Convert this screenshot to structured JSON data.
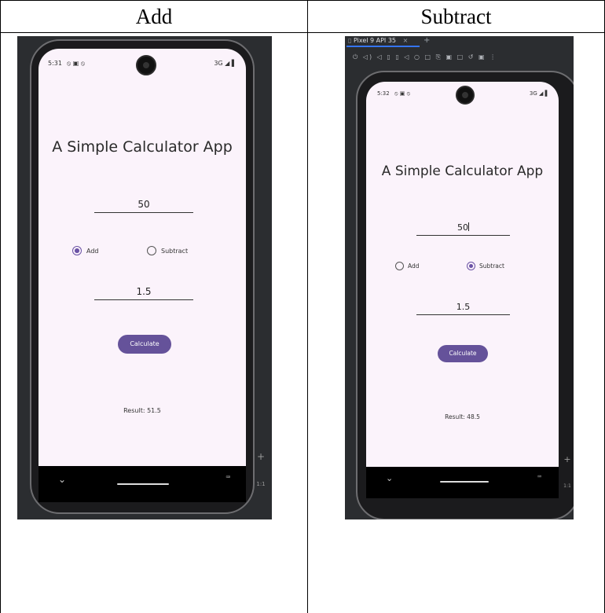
{
  "headers": {
    "left": "Add",
    "right": "Subtract"
  },
  "left_phone": {
    "time": "5:31",
    "status_icons": "⦸ ▣ ⦸",
    "network": "3G ◢ ▌",
    "title": "A Simple Calculator App",
    "first_number": "50",
    "radio_add_label": "Add",
    "radio_subtract_label": "Subtract",
    "selected": "add",
    "second_number": "1.5",
    "button_label": "Calculate",
    "result": "Result: 51.5",
    "side_plus": "+",
    "side_ratio": "1:1"
  },
  "right_phone": {
    "emulator_tab": "Pixel 9 API 35",
    "emulator_tab_close": "×",
    "emulator_new_tab": "+",
    "toolbar_icons": "⏻ ◁) ◁ ▯ ▯ ◁ ○ □ ⎘ ▣ □ ↺ ▣ ⋮",
    "time": "5:32",
    "status_icons": "⦸ ▣ ⦸",
    "network": "3G ◢ ▌",
    "title": "A Simple Calculator App",
    "first_number": "50",
    "radio_add_label": "Add",
    "radio_subtract_label": "Subtract",
    "selected": "subtract",
    "second_number": "1.5",
    "button_label": "Calculate",
    "result": "Result: 48.5",
    "side_plus": "+",
    "side_ratio": "1:1"
  },
  "colors": {
    "accent": "#65529a",
    "screen_bg": "#fbf3fb",
    "emulator_bg": "#2b2d30"
  }
}
